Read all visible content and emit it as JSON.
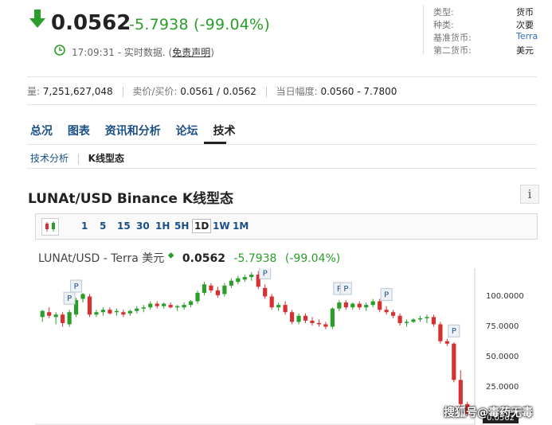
{
  "quote": {
    "price": "0.0562",
    "change": "-5.7938",
    "change_pct": "(-99.04%)",
    "time": "17:09:31",
    "realtime_label": " - 实时数据. (",
    "disclaimer": "免责声明",
    "close_paren": ")"
  },
  "meta": [
    {
      "label": "类型:",
      "value": "货币"
    },
    {
      "label": "种类:",
      "value": "次要"
    },
    {
      "label": "基准货币:",
      "value": "Terra"
    },
    {
      "label": "第二货币:",
      "value": "美元"
    }
  ],
  "stats": {
    "volume_label": "量:",
    "volume": "7,251,627,048",
    "bidask_label": "卖价/买价:",
    "bidask": "0.0561 / 0.0562",
    "range_label": "当日幅度:",
    "range": "0.0560 - 7.7800"
  },
  "nav": [
    "总况",
    "图表",
    "资讯和分析",
    "论坛",
    "技术"
  ],
  "subnav": {
    "item1": "技术分析",
    "item2": "K线型态"
  },
  "section_title": "LUNAt/USD Binance K线型态",
  "info_icon": "i",
  "timeframes": [
    "1",
    "5",
    "15",
    "30",
    "1H",
    "5H",
    "1D",
    "1W",
    "1M"
  ],
  "chart_header": {
    "name": "LUNAt/USD - Terra 美元",
    "last": "0.0562",
    "change": "-5.7938",
    "change_pct": "(-99.04%)"
  },
  "watermark": "搜狐号@毒药无毒",
  "colors": {
    "up": "#2a9d2a",
    "down": "#d63031",
    "link": "#1a4f86"
  },
  "chart_data": {
    "type": "candlestick",
    "y_ticks": [
      "100.0000",
      "75.0000",
      "50.0000",
      "25.0000"
    ],
    "ylim": [
      0,
      130
    ],
    "last_price_tag": "0.0562",
    "pattern_marker": "P",
    "candles": [
      {
        "o": 84,
        "h": 90,
        "l": 80,
        "c": 89
      },
      {
        "o": 88,
        "h": 92,
        "l": 83,
        "c": 85
      },
      {
        "o": 84,
        "h": 88,
        "l": 78,
        "c": 86
      },
      {
        "o": 86,
        "h": 88,
        "l": 76,
        "c": 79
      },
      {
        "o": 78,
        "h": 90,
        "l": 76,
        "c": 88
      },
      {
        "o": 86,
        "h": 100,
        "l": 84,
        "c": 98
      },
      {
        "o": 99,
        "h": 104,
        "l": 96,
        "c": 103
      },
      {
        "o": 101,
        "h": 103,
        "l": 84,
        "c": 86
      },
      {
        "o": 86,
        "h": 90,
        "l": 84,
        "c": 88
      },
      {
        "o": 88,
        "h": 92,
        "l": 85,
        "c": 90
      },
      {
        "o": 90,
        "h": 92,
        "l": 86,
        "c": 87
      },
      {
        "o": 88,
        "h": 91,
        "l": 85,
        "c": 89
      },
      {
        "o": 88,
        "h": 90,
        "l": 84,
        "c": 86
      },
      {
        "o": 87,
        "h": 90,
        "l": 85,
        "c": 89
      },
      {
        "o": 89,
        "h": 93,
        "l": 87,
        "c": 91
      },
      {
        "o": 91,
        "h": 94,
        "l": 88,
        "c": 92
      },
      {
        "o": 92,
        "h": 97,
        "l": 90,
        "c": 95
      },
      {
        "o": 95,
        "h": 97,
        "l": 91,
        "c": 93
      },
      {
        "o": 93,
        "h": 96,
        "l": 91,
        "c": 95
      },
      {
        "o": 94,
        "h": 96,
        "l": 91,
        "c": 92
      },
      {
        "o": 92,
        "h": 94,
        "l": 89,
        "c": 93
      },
      {
        "o": 92,
        "h": 96,
        "l": 90,
        "c": 94
      },
      {
        "o": 94,
        "h": 98,
        "l": 92,
        "c": 97
      },
      {
        "o": 97,
        "h": 106,
        "l": 95,
        "c": 104
      },
      {
        "o": 104,
        "h": 113,
        "l": 102,
        "c": 111
      },
      {
        "o": 110,
        "h": 112,
        "l": 104,
        "c": 106
      },
      {
        "o": 106,
        "h": 109,
        "l": 100,
        "c": 102
      },
      {
        "o": 103,
        "h": 112,
        "l": 101,
        "c": 110
      },
      {
        "o": 110,
        "h": 116,
        "l": 108,
        "c": 114
      },
      {
        "o": 113,
        "h": 118,
        "l": 111,
        "c": 116
      },
      {
        "o": 115,
        "h": 119,
        "l": 113,
        "c": 117
      },
      {
        "o": 117,
        "h": 121,
        "l": 114,
        "c": 119
      },
      {
        "o": 119,
        "h": 122,
        "l": 107,
        "c": 109
      },
      {
        "o": 108,
        "h": 111,
        "l": 99,
        "c": 101
      },
      {
        "o": 101,
        "h": 103,
        "l": 90,
        "c": 92
      },
      {
        "o": 92,
        "h": 96,
        "l": 89,
        "c": 94
      },
      {
        "o": 94,
        "h": 97,
        "l": 86,
        "c": 88
      },
      {
        "o": 88,
        "h": 90,
        "l": 78,
        "c": 80
      },
      {
        "o": 80,
        "h": 87,
        "l": 78,
        "c": 85
      },
      {
        "o": 85,
        "h": 87,
        "l": 79,
        "c": 81
      },
      {
        "o": 81,
        "h": 84,
        "l": 77,
        "c": 79
      },
      {
        "o": 79,
        "h": 82,
        "l": 76,
        "c": 78
      },
      {
        "o": 78,
        "h": 80,
        "l": 74,
        "c": 76
      },
      {
        "o": 76,
        "h": 92,
        "l": 74,
        "c": 91
      },
      {
        "o": 91,
        "h": 98,
        "l": 89,
        "c": 96
      },
      {
        "o": 96,
        "h": 98,
        "l": 90,
        "c": 92
      },
      {
        "o": 92,
        "h": 96,
        "l": 90,
        "c": 95
      },
      {
        "o": 95,
        "h": 97,
        "l": 90,
        "c": 92
      },
      {
        "o": 92,
        "h": 96,
        "l": 89,
        "c": 94
      },
      {
        "o": 94,
        "h": 99,
        "l": 92,
        "c": 97
      },
      {
        "o": 97,
        "h": 99,
        "l": 88,
        "c": 90
      },
      {
        "o": 90,
        "h": 93,
        "l": 86,
        "c": 88
      },
      {
        "o": 88,
        "h": 90,
        "l": 83,
        "c": 85
      },
      {
        "o": 85,
        "h": 87,
        "l": 77,
        "c": 79
      },
      {
        "o": 79,
        "h": 82,
        "l": 76,
        "c": 80
      },
      {
        "o": 80,
        "h": 83,
        "l": 79,
        "c": 82
      },
      {
        "o": 82,
        "h": 85,
        "l": 80,
        "c": 83
      },
      {
        "o": 83,
        "h": 86,
        "l": 79,
        "c": 84
      },
      {
        "o": 84,
        "h": 86,
        "l": 76,
        "c": 78
      },
      {
        "o": 78,
        "h": 80,
        "l": 62,
        "c": 64
      },
      {
        "o": 64,
        "h": 66,
        "l": 60,
        "c": 62
      },
      {
        "o": 62,
        "h": 63,
        "l": 30,
        "c": 32
      },
      {
        "o": 32,
        "h": 40,
        "l": 10,
        "c": 12
      },
      {
        "o": 12,
        "h": 14,
        "l": 2,
        "c": 4
      }
    ],
    "pattern_markers_at": [
      4,
      5,
      33,
      44,
      45,
      51,
      61
    ]
  }
}
